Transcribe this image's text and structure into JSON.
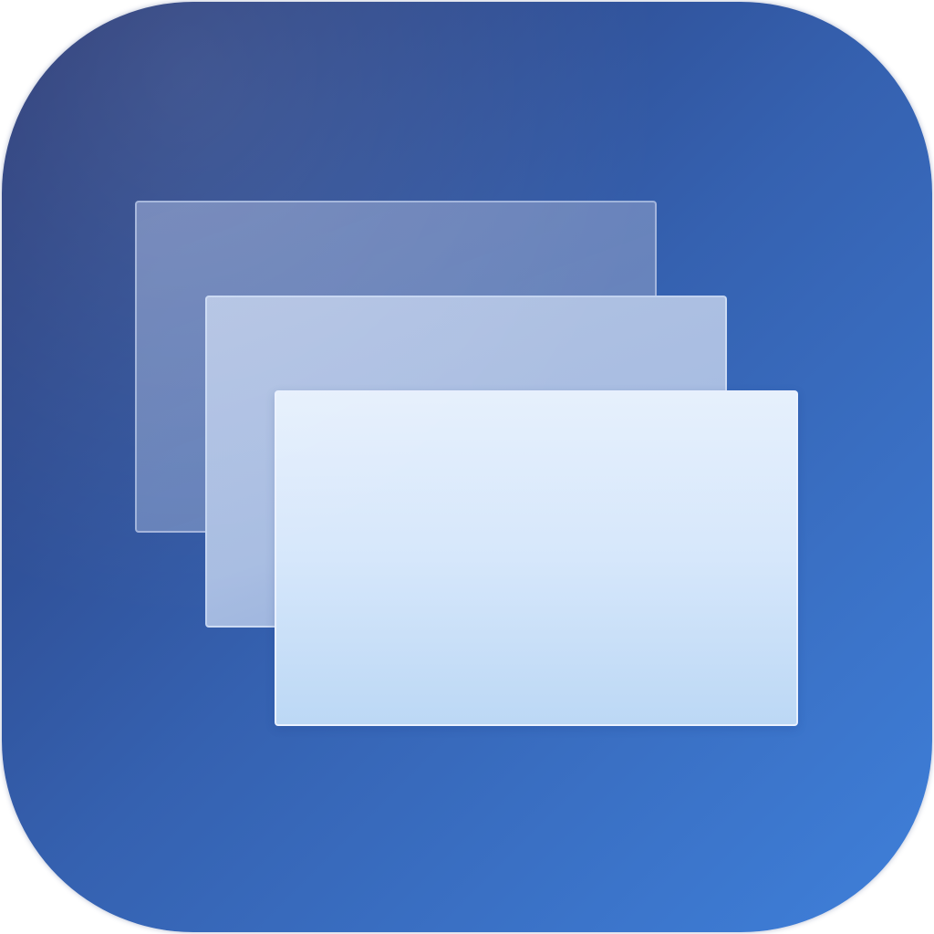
{
  "icon": {
    "name": "stacked-windows-app-icon",
    "symbol": "three-overlapping-windows-icon",
    "colors": {
      "background_top_left": "#283874",
      "background_bottom_right": "#3F80DA",
      "pane_back": "#6E8BC0",
      "pane_middle": "#A8BDE2",
      "pane_front_top": "#E6F0FC",
      "pane_front_bottom": "#BCD8F5"
    }
  }
}
